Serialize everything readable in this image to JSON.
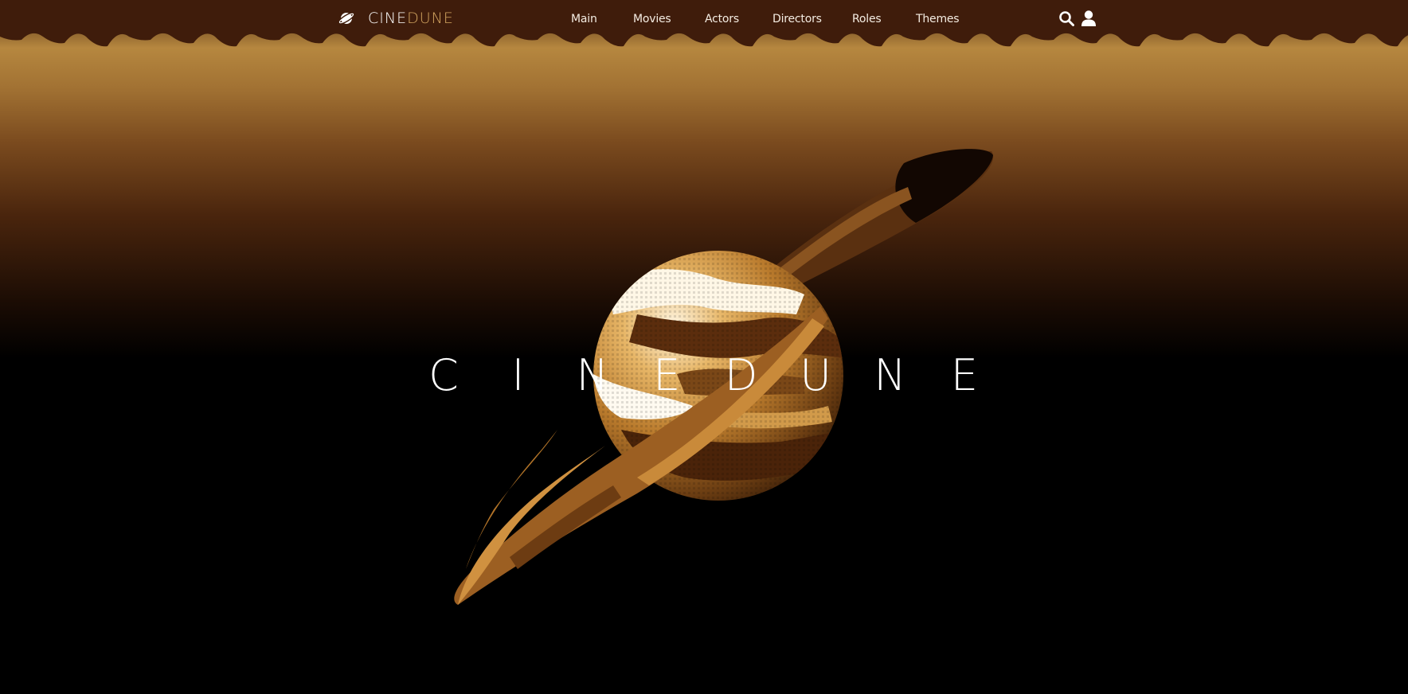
{
  "brand": {
    "logo_text_part1": "CINE",
    "logo_text_part2": "DUNE",
    "logo_icon": "planet-icon",
    "accent_color": "#d3a560",
    "bar_color": "#3f1c0b"
  },
  "nav": {
    "items": [
      {
        "label": "Main"
      },
      {
        "label": "Movies"
      },
      {
        "label": "Actors"
      },
      {
        "label": "Directors"
      },
      {
        "label": "Roles"
      },
      {
        "label": "Themes"
      }
    ]
  },
  "header_icons": {
    "search": "search-icon",
    "account": "user-icon"
  },
  "hero": {
    "title": "CINEDUNE",
    "art": "pixel-art-ringed-planet"
  }
}
